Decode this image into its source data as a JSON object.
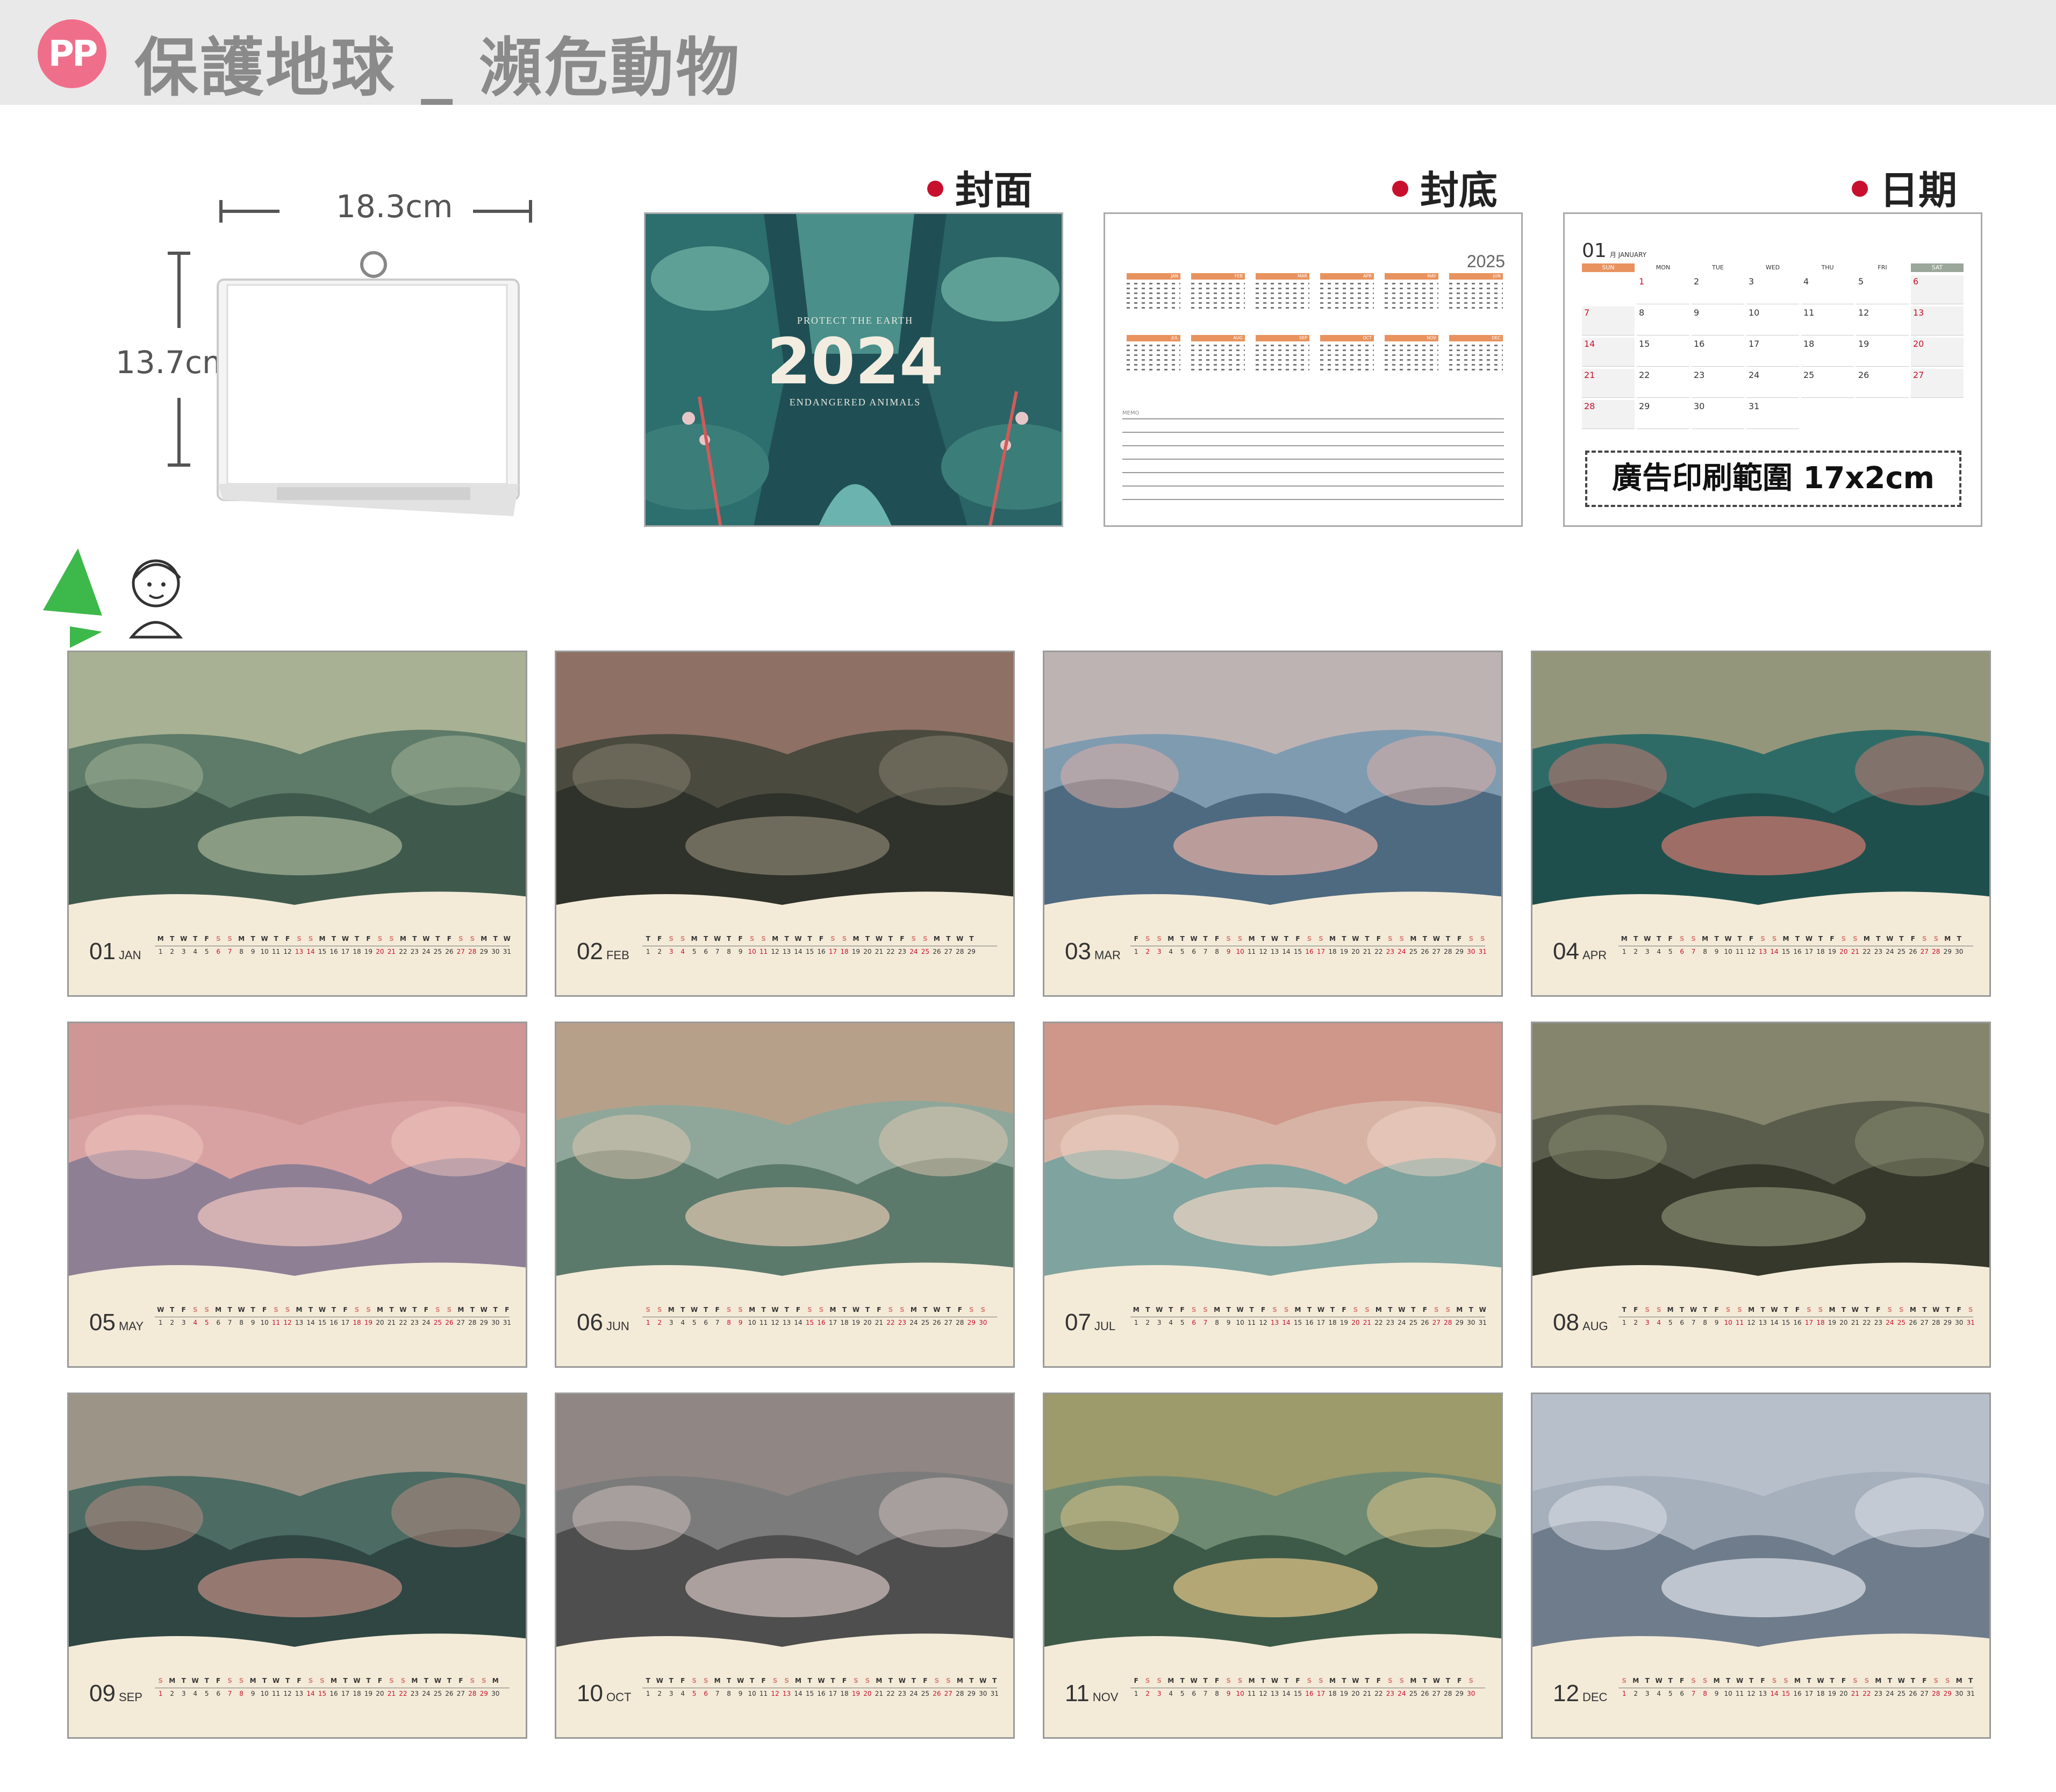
{
  "header": {
    "logo_text": "PP",
    "title": "保護地球 _ 瀕危動物"
  },
  "product": {
    "width_label": "18.3cm",
    "height_label": "13.7cm"
  },
  "sections": {
    "cover_label": "封面",
    "back_label": "封底",
    "date_label": "日期"
  },
  "cover": {
    "subtitle_top": "PROTECT THE EARTH",
    "year": "2024",
    "subtitle_bottom": "ENDANGERED ANIMALS"
  },
  "back": {
    "year": "2025",
    "months": [
      "JAN",
      "FEB",
      "MAR",
      "APR",
      "MAY",
      "JUN",
      "JUL",
      "AUG",
      "SEP",
      "OCT",
      "NOV",
      "DEC"
    ],
    "memo_label": "MEMO"
  },
  "date_page": {
    "month_num": "01",
    "month_name": "月 JANUARY",
    "weekdays": [
      "SUN",
      "MON",
      "TUE",
      "WED",
      "THU",
      "FRI",
      "SAT"
    ],
    "days": [
      "1",
      "2",
      "3",
      "4",
      "5",
      "6",
      "7",
      "8",
      "9",
      "10",
      "11",
      "12",
      "13",
      "14",
      "15",
      "16",
      "17",
      "18",
      "19",
      "20",
      "21",
      "22",
      "23",
      "24",
      "25",
      "26",
      "27",
      "28",
      "29",
      "30",
      "31"
    ],
    "ad_area": "廣告印刷範圍 17x2cm"
  },
  "months": [
    {
      "num": "01",
      "name": "JAN"
    },
    {
      "num": "02",
      "name": "FEB"
    },
    {
      "num": "03",
      "name": "MAR"
    },
    {
      "num": "04",
      "name": "APR"
    },
    {
      "num": "05",
      "name": "MAY"
    },
    {
      "num": "06",
      "name": "JUN"
    },
    {
      "num": "07",
      "name": "JUL"
    },
    {
      "num": "08",
      "name": "AUG"
    },
    {
      "num": "09",
      "name": "SEP"
    },
    {
      "num": "10",
      "name": "OCT"
    },
    {
      "num": "11",
      "name": "NOV"
    },
    {
      "num": "12",
      "name": "DEC"
    }
  ],
  "colors": {
    "header_bg": "#e9e9e9",
    "logo_pink": "#ef6f8b",
    "accent_red": "#c8102e",
    "card_cream": "#f3ead8",
    "calendar_orange": "#e8935f"
  }
}
